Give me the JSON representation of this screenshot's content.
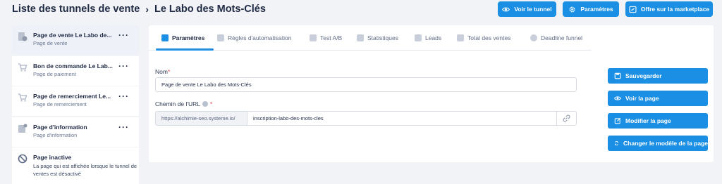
{
  "header": {
    "breadcrumb_root": "Liste des tunnels de vente",
    "breadcrumb_sep": "›",
    "breadcrumb_current": "Le Labo des Mots-Clés",
    "buttons": [
      {
        "label": "Voir le tunnel",
        "icon": "eye-icon"
      },
      {
        "label": "Paramètres",
        "icon": "gear-icon"
      },
      {
        "label": "Offre sur la marketplace",
        "icon": "store-icon"
      }
    ]
  },
  "sidebar": {
    "items": [
      {
        "title": "Page de vente Le Labo de...",
        "subtitle": "Page de vente",
        "icon": "sales-page-icon",
        "active": true
      },
      {
        "title": "Bon de commande Le Lab...",
        "subtitle": "Page de paiement",
        "icon": "cart-icon"
      },
      {
        "title": "Page de remerciement Le...",
        "subtitle": "Page de remerciement",
        "icon": "cart-check-icon"
      },
      {
        "title": "Page d'information",
        "subtitle": "Page d'information",
        "icon": "info-page-icon"
      }
    ],
    "inactive": {
      "title": "Page inactive",
      "description": "La page qui est affichée lorsque le tunnel de ventes est désactivé",
      "icon": "disabled-icon"
    }
  },
  "tabs": [
    {
      "label": "Paramètres",
      "active": true
    },
    {
      "label": "Règles d'automatisation"
    },
    {
      "label": "Test A/B"
    },
    {
      "label": "Statistiques"
    },
    {
      "label": "Leads"
    },
    {
      "label": "Total des ventes"
    },
    {
      "label": "Deadline funnel"
    }
  ],
  "form": {
    "name_label": "Nom",
    "name_value": "Page de vente Le Labo des Mots-Clés",
    "url_label": "Chemin de l'URL",
    "url_prefix": "https://alchimie-seo.systeme.io/",
    "url_value": "inscription-labo-des-mots-cles",
    "required_mark": "*"
  },
  "actions": {
    "save": "Sauvegarder",
    "view_page": "Voir la page",
    "edit_page": "Modifier la page",
    "change_template": "Changer le modèle de la page"
  },
  "colors": {
    "primary": "#1b8fe3",
    "background": "#f1f3f6",
    "text": "#1f2a44",
    "required": "#e0474c"
  }
}
